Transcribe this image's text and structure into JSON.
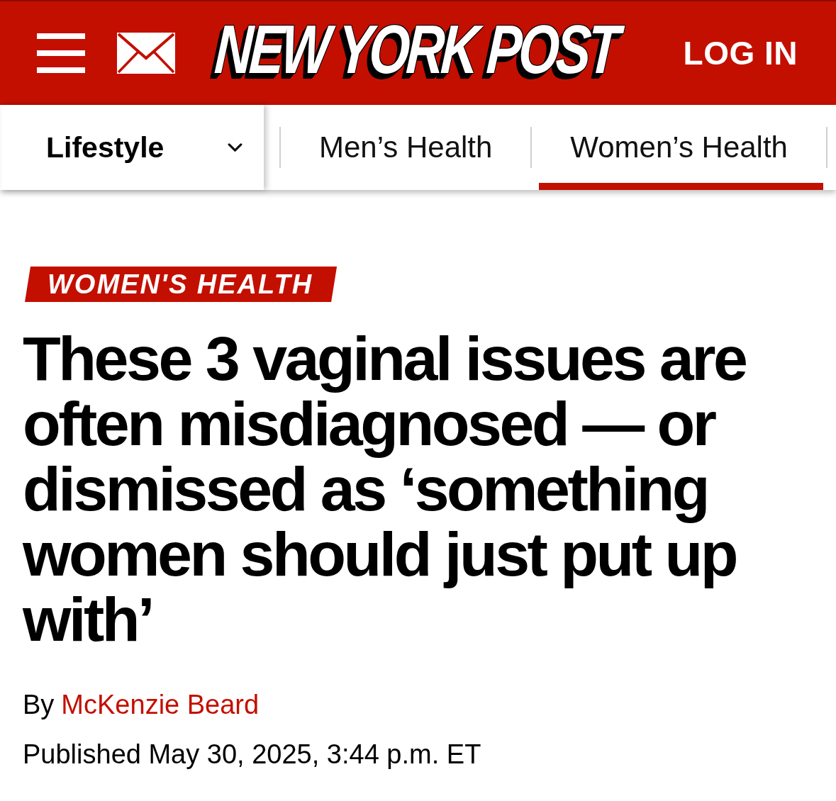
{
  "header": {
    "logo": "NEW YORK POST",
    "login": "LOG IN"
  },
  "nav": {
    "section": {
      "label": "Lifestyle"
    },
    "tabs": [
      {
        "label": "Men’s Health",
        "selected": false
      },
      {
        "label": "Women’s Health",
        "selected": true
      }
    ]
  },
  "article": {
    "kicker": "WOMEN'S HEALTH",
    "headline": "These 3 vaginal issues are often misdiagnosed — or dismissed as ‘something women should just put up with’",
    "byline": {
      "prefix": "By",
      "author": "McKenzie Beard"
    },
    "published": "Published May 30, 2025, 3:44 p.m. ET"
  }
}
